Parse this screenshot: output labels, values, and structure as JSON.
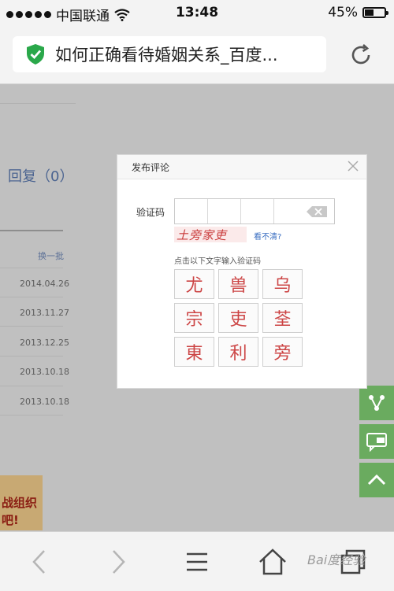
{
  "status_bar": {
    "carrier": "中国联通",
    "time": "13:48",
    "battery": "45%",
    "battery_level": 0.45
  },
  "address_bar": {
    "title": "如何正确看待婚姻关系_百度..."
  },
  "page": {
    "reply_label": "回复（0）",
    "swap_label": "换一批",
    "dates": [
      "2014.04.26",
      "2013.11.27",
      "2013.12.25",
      "2013.10.18",
      "2013.10.18"
    ],
    "banner_lines": [
      "战组织",
      "吧!"
    ]
  },
  "dialog": {
    "title": "发布评论",
    "code_label": "验证码",
    "captcha_text": "土旁家吏",
    "cant_see_link": "看不清?",
    "hint": "点击以下文字输入验证码",
    "chars": [
      "尤",
      "兽",
      "乌",
      "宗",
      "吏",
      "荃",
      "東",
      "利",
      "旁"
    ]
  },
  "watermark": "Bai度经验",
  "colors": {
    "accent_green": "#6aab5f",
    "shield_green": "#2aa84a",
    "link_blue": "#3b6fc2"
  }
}
